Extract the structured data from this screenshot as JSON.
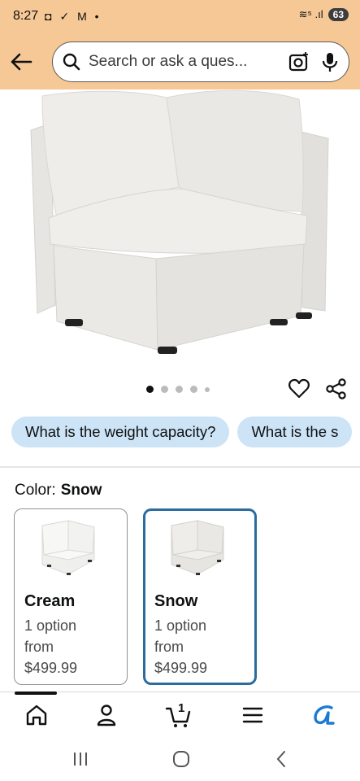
{
  "status_bar": {
    "time": "8:27",
    "notification_icons": "◘ ✓ M •",
    "network": "≋⁵ .ıl",
    "battery": "63"
  },
  "search": {
    "placeholder": "Search or ask a ques..."
  },
  "gallery": {
    "image_count": 5,
    "active_index": 0
  },
  "questions": [
    "What is the weight capacity?",
    "What is the s"
  ],
  "color": {
    "label": "Color:",
    "selected": "Snow"
  },
  "swatches": [
    {
      "name": "Cream",
      "options": "1 option",
      "from_label": "from",
      "price": "$499.99",
      "selected": false
    },
    {
      "name": "Snow",
      "options": "1 option",
      "from_label": "from",
      "price": "$499.99",
      "selected": true
    }
  ],
  "bottom_nav": {
    "cart_count": "1",
    "items": [
      "home-icon",
      "account-icon",
      "cart-icon",
      "menu-icon",
      "rufus-icon"
    ]
  },
  "colors": {
    "header_bg": "#f6c896",
    "chip_bg": "#cde3f6",
    "selected_border": "#2b6c9e"
  }
}
